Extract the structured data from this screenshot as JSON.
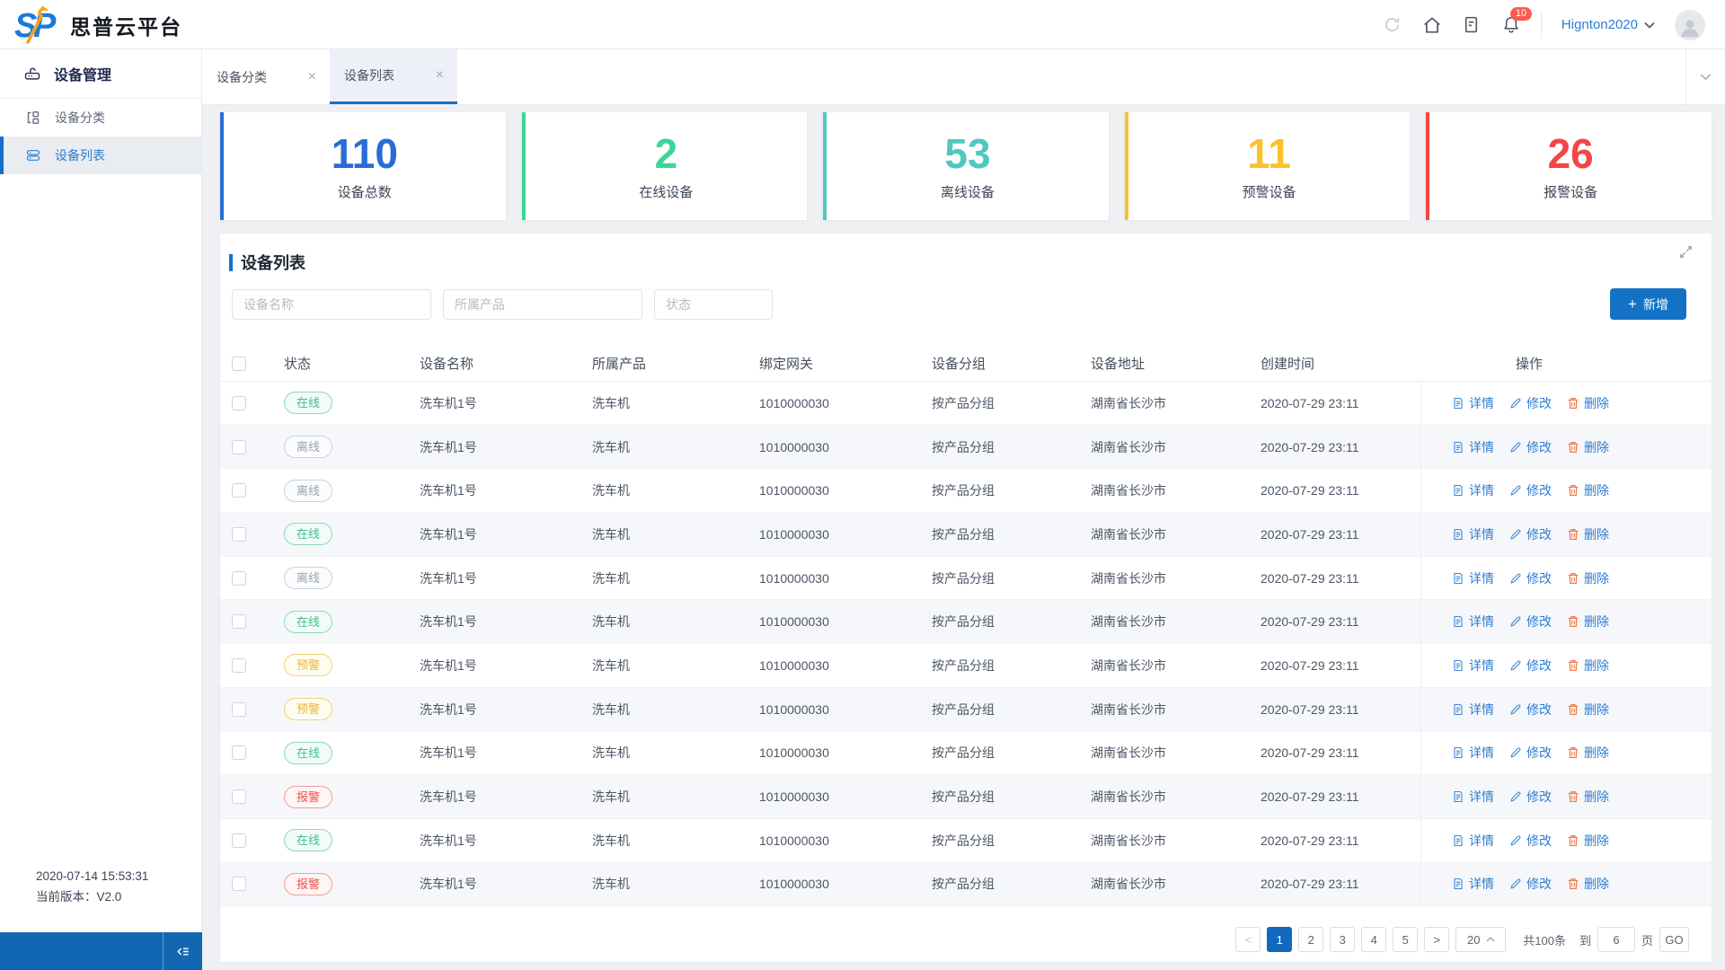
{
  "header": {
    "brand_title": "思普云平台",
    "logo_text": "SP",
    "username": "Hignton2020",
    "notification_count": "10"
  },
  "sidebar": {
    "title": "设备管理",
    "items": [
      {
        "label": "设备分类",
        "active": false
      },
      {
        "label": "设备列表",
        "active": true
      }
    ],
    "footer_time": "2020-07-14 15:53:31",
    "footer_version": "当前版本：V2.0"
  },
  "tabs": [
    {
      "label": "设备分类",
      "active": false
    },
    {
      "label": "设备列表",
      "active": true
    }
  ],
  "stats": [
    {
      "value": "110",
      "label": "设备总数",
      "color": "#2a6cd5"
    },
    {
      "value": "2",
      "label": "在线设备",
      "color": "#3dd598"
    },
    {
      "value": "53",
      "label": "离线设备",
      "color": "#4fc8c0"
    },
    {
      "value": "11",
      "label": "预警设备",
      "color": "#fbc02d"
    },
    {
      "value": "26",
      "label": "报警设备",
      "color": "#f54545"
    }
  ],
  "panel": {
    "title": "设备列表",
    "filters": [
      {
        "placeholder": "设备名称"
      },
      {
        "placeholder": "所属产品"
      },
      {
        "placeholder": "状态"
      }
    ],
    "add_button": "新增"
  },
  "table": {
    "columns": [
      "状态",
      "设备名称",
      "所属产品",
      "绑定网关",
      "设备分组",
      "设备地址",
      "创建时间",
      "操作"
    ],
    "actions": {
      "detail": "详情",
      "edit": "修改",
      "delete": "删除"
    },
    "rows": [
      {
        "status": "在线",
        "status_type": "online",
        "name": "洗车机1号",
        "product": "洗车机",
        "gateway": "1010000030",
        "group": "按产品分组",
        "address": "湖南省长沙市",
        "created": "2020-07-29 23:11"
      },
      {
        "status": "离线",
        "status_type": "offline",
        "name": "洗车机1号",
        "product": "洗车机",
        "gateway": "1010000030",
        "group": "按产品分组",
        "address": "湖南省长沙市",
        "created": "2020-07-29 23:11"
      },
      {
        "status": "离线",
        "status_type": "offline",
        "name": "洗车机1号",
        "product": "洗车机",
        "gateway": "1010000030",
        "group": "按产品分组",
        "address": "湖南省长沙市",
        "created": "2020-07-29 23:11"
      },
      {
        "status": "在线",
        "status_type": "online",
        "name": "洗车机1号",
        "product": "洗车机",
        "gateway": "1010000030",
        "group": "按产品分组",
        "address": "湖南省长沙市",
        "created": "2020-07-29 23:11"
      },
      {
        "status": "离线",
        "status_type": "offline",
        "name": "洗车机1号",
        "product": "洗车机",
        "gateway": "1010000030",
        "group": "按产品分组",
        "address": "湖南省长沙市",
        "created": "2020-07-29 23:11"
      },
      {
        "status": "在线",
        "status_type": "online",
        "name": "洗车机1号",
        "product": "洗车机",
        "gateway": "1010000030",
        "group": "按产品分组",
        "address": "湖南省长沙市",
        "created": "2020-07-29 23:11"
      },
      {
        "status": "预警",
        "status_type": "warning",
        "name": "洗车机1号",
        "product": "洗车机",
        "gateway": "1010000030",
        "group": "按产品分组",
        "address": "湖南省长沙市",
        "created": "2020-07-29 23:11"
      },
      {
        "status": "预警",
        "status_type": "warning",
        "name": "洗车机1号",
        "product": "洗车机",
        "gateway": "1010000030",
        "group": "按产品分组",
        "address": "湖南省长沙市",
        "created": "2020-07-29 23:11"
      },
      {
        "status": "在线",
        "status_type": "online",
        "name": "洗车机1号",
        "product": "洗车机",
        "gateway": "1010000030",
        "group": "按产品分组",
        "address": "湖南省长沙市",
        "created": "2020-07-29 23:11"
      },
      {
        "status": "报警",
        "status_type": "alarm",
        "name": "洗车机1号",
        "product": "洗车机",
        "gateway": "1010000030",
        "group": "按产品分组",
        "address": "湖南省长沙市",
        "created": "2020-07-29 23:11"
      },
      {
        "status": "在线",
        "status_type": "online",
        "name": "洗车机1号",
        "product": "洗车机",
        "gateway": "1010000030",
        "group": "按产品分组",
        "address": "湖南省长沙市",
        "created": "2020-07-29 23:11"
      },
      {
        "status": "报警",
        "status_type": "alarm",
        "name": "洗车机1号",
        "product": "洗车机",
        "gateway": "1010000030",
        "group": "按产品分组",
        "address": "湖南省长沙市",
        "created": "2020-07-29 23:11"
      }
    ]
  },
  "pagination": {
    "pages": [
      "1",
      "2",
      "3",
      "4",
      "5"
    ],
    "active_page": "1",
    "page_size": "20",
    "total": "共100条",
    "jump_prefix": "到",
    "jump_value": "6",
    "jump_suffix": "页",
    "go_label": "GO"
  },
  "icons": {
    "refresh-icon": "↻",
    "home-icon": "⌂",
    "document-icon": "🗎",
    "bell-icon": "🔔",
    "chevron-down-icon": "⌄",
    "close-icon": "×",
    "expand-icon": "⤢",
    "plus-icon": "+",
    "detail-icon": "🗎",
    "edit-icon": "✎",
    "delete-icon": "🗑",
    "collapse-icon": "⇤",
    "caret-up-icon": "⌃",
    "prev-icon": "<",
    "next-icon": ">"
  },
  "colors": {
    "primary": "#1372c8",
    "sidebar_bottom_bar": "#1267b2",
    "notification_badge": "#fb5a50",
    "badge_online": "#3fc08c",
    "badge_offline": "#9ba3ae",
    "badge_warning": "#edb432",
    "badge_alarm": "#f25048",
    "delete_icon": "#ed7b49",
    "link": "#2d7dd2"
  }
}
